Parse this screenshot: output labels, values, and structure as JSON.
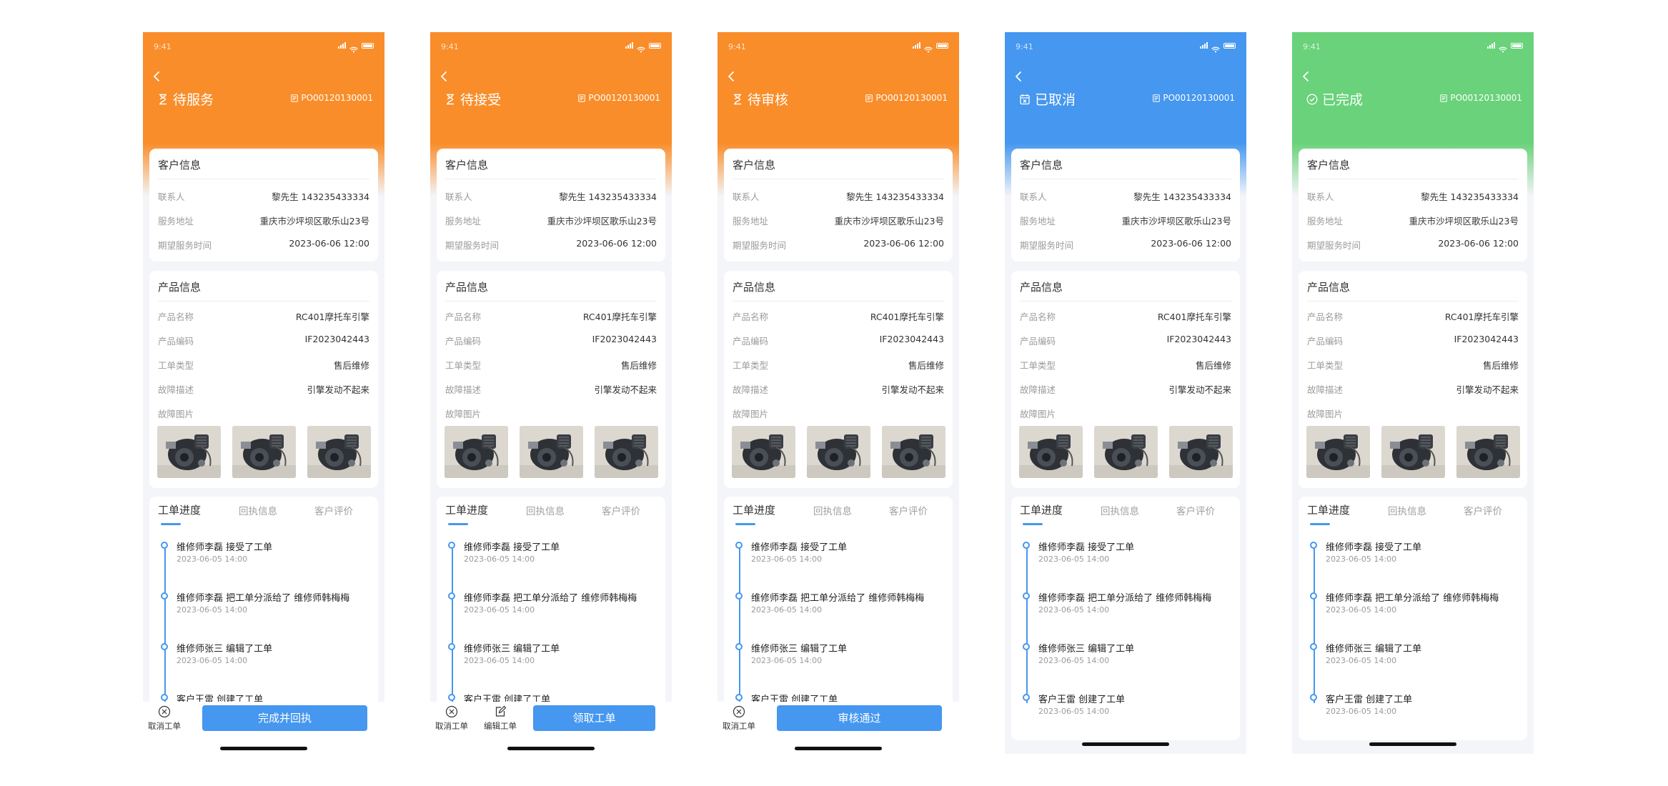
{
  "status_bar": {
    "time": "9:41"
  },
  "order_no": "PO00120130001",
  "customer": {
    "title": "客户信息",
    "fields": [
      {
        "label": "联系人",
        "value": "黎先生 143235433334"
      },
      {
        "label": "服务地址",
        "value": "重庆市沙坪坝区歌乐山23号"
      },
      {
        "label": "期望服务时间",
        "value": "2023-06-06 12:00"
      }
    ]
  },
  "product": {
    "title": "产品信息",
    "fields": [
      {
        "label": "产品名称",
        "value": "RC401摩托车引擎"
      },
      {
        "label": "产品编码",
        "value": "IF2023042443"
      },
      {
        "label": "工单类型",
        "value": "售后维修"
      },
      {
        "label": "故障描述",
        "value": "引擎发动不起来"
      }
    ],
    "photos_label": "故障图片"
  },
  "tabs": [
    "工单进度",
    "回执信息",
    "客户评价"
  ],
  "timeline": [
    {
      "text": "维修师李磊 接受了工单",
      "time": "2023-06-05 14:00"
    },
    {
      "text": "维修师李磊 把工单分派给了 维修师韩梅梅",
      "time": "2023-06-05 14:00"
    },
    {
      "text": "维修师张三 编辑了工单",
      "time": "2023-06-05 14:00"
    },
    {
      "text": "客户王雷 创建了工单",
      "time": "2023-06-05 14:00"
    }
  ],
  "screens": [
    {
      "status": "待服务",
      "status_icon": "hourglass-icon",
      "header_color": "#f98d2a",
      "actions": [
        {
          "label": "取消工单",
          "icon": "cancel-icon"
        }
      ],
      "primary_button": "完成并回执"
    },
    {
      "status": "待接受",
      "status_icon": "hourglass-icon",
      "header_color": "#f98d2a",
      "actions": [
        {
          "label": "取消工单",
          "icon": "cancel-icon"
        },
        {
          "label": "编辑工单",
          "icon": "edit-icon"
        }
      ],
      "primary_button": "领取工单"
    },
    {
      "status": "待审核",
      "status_icon": "hourglass-icon",
      "header_color": "#f98d2a",
      "actions": [
        {
          "label": "取消工单",
          "icon": "cancel-icon"
        }
      ],
      "primary_button": "审核通过"
    },
    {
      "status": "已取消",
      "status_icon": "cancelled-calendar-icon",
      "header_color": "#4597ef",
      "actions": [],
      "primary_button": ""
    },
    {
      "status": "已完成",
      "status_icon": "check-circle-icon",
      "header_color": "#69d27a",
      "actions": [],
      "primary_button": ""
    }
  ],
  "colors": {
    "accent": "#4597ef",
    "orange": "#f98d2a",
    "blue": "#4597ef",
    "green": "#69d27a"
  }
}
